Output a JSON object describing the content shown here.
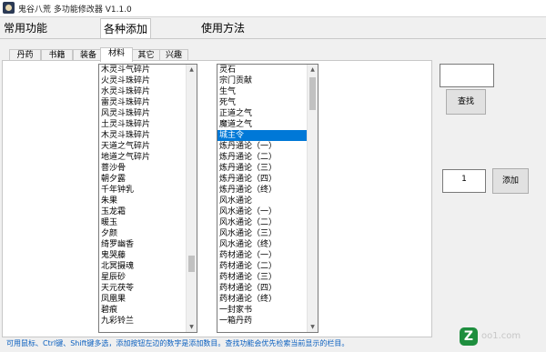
{
  "window": {
    "title": "鬼谷八荒 多功能修改器 V1.1.0"
  },
  "top_tabs": [
    "常用功能",
    "各种添加",
    "使用方法"
  ],
  "sub_tabs": [
    "丹药",
    "书籍",
    "装备",
    "材料",
    "其它",
    "兴趣"
  ],
  "materials_list": [
    "木灵斗气碎片",
    "火灵斗珠碎片",
    "水灵斗珠碎片",
    "雷灵斗珠碎片",
    "风灵斗珠碎片",
    "土灵斗珠碎片",
    "木灵斗珠碎片",
    "天道之气碎片",
    "地道之气碎片",
    "菩沙骨",
    "朝夕露",
    "千年钟乳",
    "朱果",
    "玉龙霜",
    "暖玉",
    "夕颜",
    "绮罗幽香",
    "鬼哭藤",
    "北冥摄魂",
    "星辰砂",
    "天元茯苓",
    "凤凰果",
    "碧痕",
    "九彩铃兰"
  ],
  "items_list": [
    "灵石",
    "宗门贡献",
    "生气",
    "死气",
    "正道之气",
    "魔道之气",
    "城主令",
    "炼丹通论（一）",
    "炼丹通论（二）",
    "炼丹通论（三）",
    "炼丹通论（四）",
    "炼丹通论（终）",
    "风水通论",
    "风水通论（一）",
    "风水通论（二）",
    "风水通论（三）",
    "风水通论（终）",
    "药材通论（一）",
    "药材通论（二）",
    "药材通论（三）",
    "药材通论（四）",
    "药材通论（终）",
    "一封家书",
    "一箱丹药"
  ],
  "search": {
    "value": "",
    "button": "查找"
  },
  "add": {
    "quantity": "1",
    "button": "添加"
  },
  "status_text": "可用鼠标、Ctrl键、Shift键多选，添加按钮左边的数字是添加数目。查找功能会优先检索当前显示的栏目。",
  "watermark": {
    "logo": "Z",
    "text": "oo1.com"
  },
  "colors": {
    "selection": "#0078d7",
    "status": "#0a5fbf"
  }
}
